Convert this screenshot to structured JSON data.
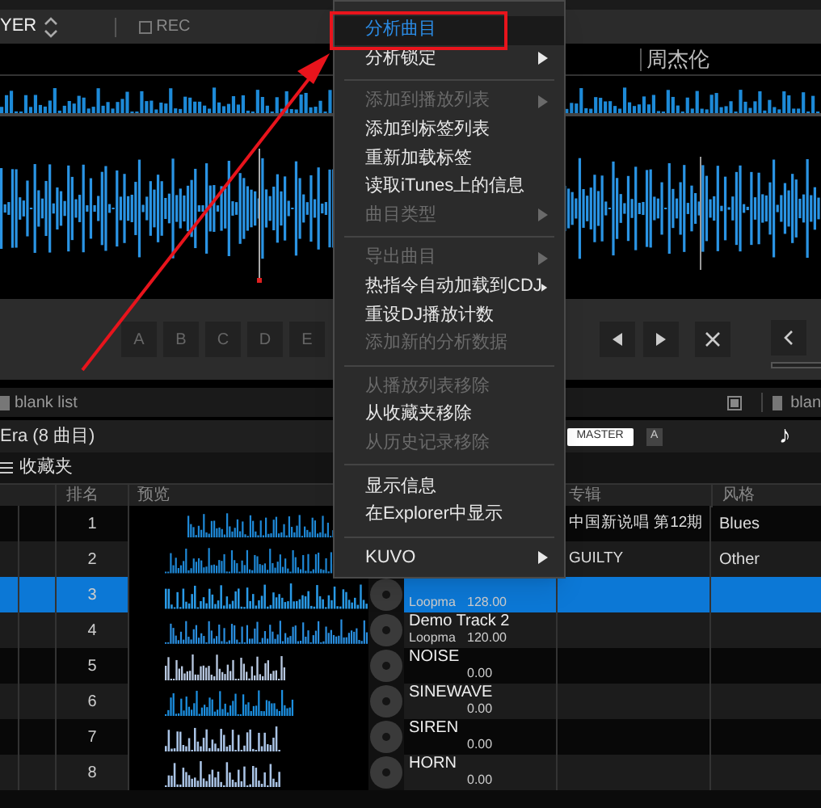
{
  "player_bar": {
    "deck_label": "YER",
    "rec_label": "REC",
    "rec_checked": false
  },
  "track": {
    "artist": "周杰伦"
  },
  "hot_cues": [
    "A",
    "B",
    "C",
    "D",
    "E"
  ],
  "list_tabs": [
    {
      "label": "blank list"
    },
    {
      "label": "blan"
    }
  ],
  "playlist": {
    "title": "Era (8 曲目)",
    "master_label": "MASTER",
    "deck_label": "A",
    "note_glyph": "♪"
  },
  "tree": {
    "label": "收藏夹"
  },
  "table": {
    "headers": {
      "rank": "排名",
      "preview": "预览",
      "album": "专辑",
      "genre": "风格"
    },
    "rows": [
      {
        "rank": "1",
        "album": "中国新说唱 第12期",
        "genre": "Blues",
        "selected": false
      },
      {
        "rank": "2",
        "album": "GUILTY",
        "genre": "Other",
        "selected": false
      },
      {
        "rank": "3",
        "artist": "Loopma",
        "bpm": "128.00",
        "selected": true
      },
      {
        "rank": "4",
        "title": "Demo Track 2",
        "artist": "Loopma",
        "bpm": "120.00",
        "selected": false
      },
      {
        "rank": "5",
        "title": "NOISE",
        "bpm": "0.00",
        "selected": false
      },
      {
        "rank": "6",
        "title": "SINEWAVE",
        "bpm": "0.00",
        "selected": false
      },
      {
        "rank": "7",
        "title": "SIREN",
        "bpm": "0.00",
        "selected": false
      },
      {
        "rank": "8",
        "title": "HORN",
        "bpm": "0.00",
        "selected": false
      }
    ]
  },
  "context_menu": {
    "items": [
      {
        "kind": "item",
        "label": "分析曲目",
        "disabled": false,
        "submenu": false,
        "selected": true
      },
      {
        "kind": "item",
        "label": "分析锁定",
        "disabled": false,
        "submenu": true,
        "selected": false
      },
      {
        "kind": "separator"
      },
      {
        "kind": "item",
        "label": "添加到播放列表",
        "disabled": true,
        "submenu": true,
        "selected": false
      },
      {
        "kind": "item",
        "label": "添加到标签列表",
        "disabled": false,
        "submenu": false,
        "selected": false
      },
      {
        "kind": "item",
        "label": "重新加载标签",
        "disabled": false,
        "submenu": false,
        "selected": false
      },
      {
        "kind": "item",
        "label": "读取iTunes上的信息",
        "disabled": false,
        "submenu": false,
        "selected": false
      },
      {
        "kind": "item",
        "label": "曲目类型",
        "disabled": true,
        "submenu": true,
        "selected": false
      },
      {
        "kind": "separator"
      },
      {
        "kind": "item",
        "label": "导出曲目",
        "disabled": true,
        "submenu": true,
        "selected": false
      },
      {
        "kind": "item",
        "label": "热指令自动加载到CDJ",
        "disabled": false,
        "submenu": true,
        "selected": false
      },
      {
        "kind": "item",
        "label": "重设DJ播放计数",
        "disabled": false,
        "submenu": false,
        "selected": false
      },
      {
        "kind": "item",
        "label": "添加新的分析数据",
        "disabled": true,
        "submenu": false,
        "selected": false
      },
      {
        "kind": "separator"
      },
      {
        "kind": "item",
        "label": "从播放列表移除",
        "disabled": true,
        "submenu": false,
        "selected": false
      },
      {
        "kind": "item",
        "label": "从收藏夹移除",
        "disabled": false,
        "submenu": false,
        "selected": false
      },
      {
        "kind": "item",
        "label": "从历史记录移除",
        "disabled": true,
        "submenu": false,
        "selected": false
      },
      {
        "kind": "separator"
      },
      {
        "kind": "item",
        "label": "显示信息",
        "disabled": false,
        "submenu": false,
        "selected": false
      },
      {
        "kind": "item",
        "label": "在Explorer中显示",
        "disabled": false,
        "submenu": false,
        "selected": false
      },
      {
        "kind": "separator"
      },
      {
        "kind": "item",
        "label": "KUVO",
        "disabled": false,
        "submenu": true,
        "selected": false
      }
    ]
  }
}
